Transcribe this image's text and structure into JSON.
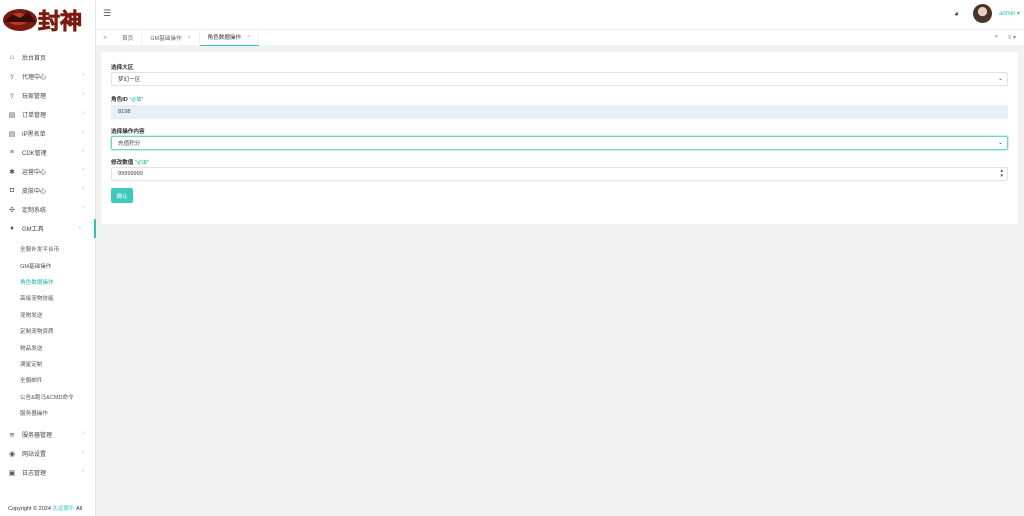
{
  "logo": {
    "text": "封神"
  },
  "sidebar": {
    "items": [
      {
        "label": "后台首页",
        "icon": "home-icon",
        "glyph": "⌂",
        "arrow": ""
      },
      {
        "label": "代理中心",
        "icon": "users-icon",
        "glyph": "ﾂ",
        "arrow": "›"
      },
      {
        "label": "玩家管理",
        "icon": "people-icon",
        "glyph": "ﾂ",
        "arrow": "›"
      },
      {
        "label": "订单管理",
        "icon": "order-icon",
        "glyph": "▤",
        "arrow": "›"
      },
      {
        "label": "IP黑名单",
        "icon": "blacklist-icon",
        "glyph": "▤",
        "arrow": "›"
      },
      {
        "label": "CDK管理",
        "icon": "cdk-icon",
        "glyph": "≡",
        "arrow": "›"
      },
      {
        "label": "运营中心",
        "icon": "gear-icon",
        "glyph": "✱",
        "arrow": "›"
      },
      {
        "label": "皮肤中心",
        "icon": "skin-icon",
        "glyph": "◘",
        "arrow": "›"
      },
      {
        "label": "定制系统",
        "icon": "custom-icon",
        "glyph": "✣",
        "arrow": "›"
      },
      {
        "label": "GM工具",
        "icon": "bulb-icon",
        "glyph": "♦",
        "arrow": "⌄"
      }
    ],
    "gm_sub": [
      "全服补发平台币",
      "GM基础操作",
      "角色数据操作",
      "高级宠物技能",
      "宠物发送",
      "定制宠物资质",
      "物品发送",
      "满星定制",
      "全服邮件",
      "公告&跑马&CMD命令",
      "服务器操作"
    ],
    "bottom_items": [
      {
        "label": "服务器管理",
        "icon": "wifi-icon",
        "glyph": "≋",
        "arrow": "›"
      },
      {
        "label": "网站设置",
        "icon": "settings-icon",
        "glyph": "◉",
        "arrow": "›"
      },
      {
        "label": "日志管理",
        "icon": "log-icon",
        "glyph": "▣",
        "arrow": "›"
      }
    ],
    "copyright_prefix": "Copyright © 2024 ",
    "copyright_link": "久远娱乐",
    "copyright_suffix": " All"
  },
  "header": {
    "user": "admin ▾"
  },
  "tabs": {
    "items": [
      {
        "label": "首页",
        "closable": false
      },
      {
        "label": "GM基础操作",
        "closable": true
      },
      {
        "label": "角色数据操作",
        "closable": true
      }
    ],
    "prev": "«",
    "next": "»",
    "menu": "≡ ▾"
  },
  "form": {
    "region_label": "选择大区",
    "region_value": "梦幻一区",
    "role_label": "角色ID",
    "role_required": "*必填*",
    "role_value": "8198",
    "op_label": "选择操作内容",
    "op_value": "充值积分",
    "mod_label": "修改数值",
    "mod_required": "*必填*",
    "mod_value": "99999999",
    "submit": "确认"
  },
  "colors": {
    "accent": "#2ec4b6",
    "button": "#3ec9be",
    "readonly_bg": "#e9eef7"
  }
}
